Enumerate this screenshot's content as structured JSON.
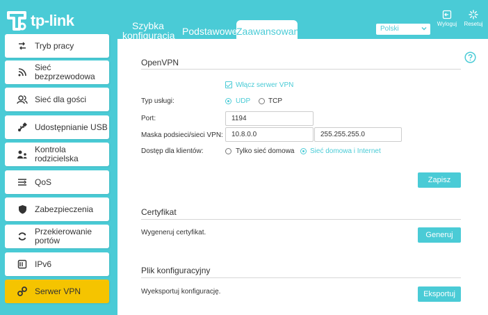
{
  "brand": {
    "logo_text": "tp-link"
  },
  "header": {
    "tabs": [
      {
        "label": "Szybka konfiguracja"
      },
      {
        "label": "Podstawowe"
      },
      {
        "label": "Zaawansowane"
      }
    ],
    "language": "Polski",
    "logout_label": "Wyloguj",
    "reset_label": "Resetuj"
  },
  "sidebar": {
    "items": [
      {
        "label": "Tryb pracy",
        "icon": "operation-mode-icon"
      },
      {
        "label": "Sieć bezprzewodowa",
        "icon": "wireless-icon"
      },
      {
        "label": "Sieć dla gości",
        "icon": "guest-network-icon"
      },
      {
        "label": "Udostępnianie USB",
        "icon": "usb-icon"
      },
      {
        "label": "Kontrola rodzicielska",
        "icon": "parental-control-icon"
      },
      {
        "label": "QoS",
        "icon": "qos-icon"
      },
      {
        "label": "Zabezpieczenia",
        "icon": "shield-icon"
      },
      {
        "label": "Przekierowanie portów",
        "icon": "port-forwarding-icon"
      },
      {
        "label": "IPv6",
        "icon": "ipv6-icon"
      },
      {
        "label": "Serwer VPN",
        "icon": "vpn-icon",
        "active": true
      }
    ]
  },
  "openvpn": {
    "title": "OpenVPN",
    "enable_label": "Włącz serwer VPN",
    "service_type_label": "Typ usługi:",
    "udp_label": "UDP",
    "tcp_label": "TCP",
    "port_label": "Port:",
    "port_value": "1194",
    "subnet_label": "Maska podsieci/sieci VPN:",
    "subnet_value": "10.8.0.0",
    "mask_value": "255.255.255.0",
    "client_access_label": "Dostęp dla klientów:",
    "home_only_label": "Tylko sieć domowa",
    "home_internet_label": "Sieć domowa i Internet",
    "save_label": "Zapisz"
  },
  "certificate": {
    "title": "Certyfikat",
    "desc": "Wygeneruj certyfikat.",
    "button_label": "Generuj"
  },
  "config_file": {
    "title": "Plik konfiguracyjny",
    "desc": "Wyeksportuj konfigurację.",
    "button_label": "Eksportuj"
  },
  "colors": {
    "accent": "#4acbd6",
    "active_nav": "#f5c400"
  }
}
